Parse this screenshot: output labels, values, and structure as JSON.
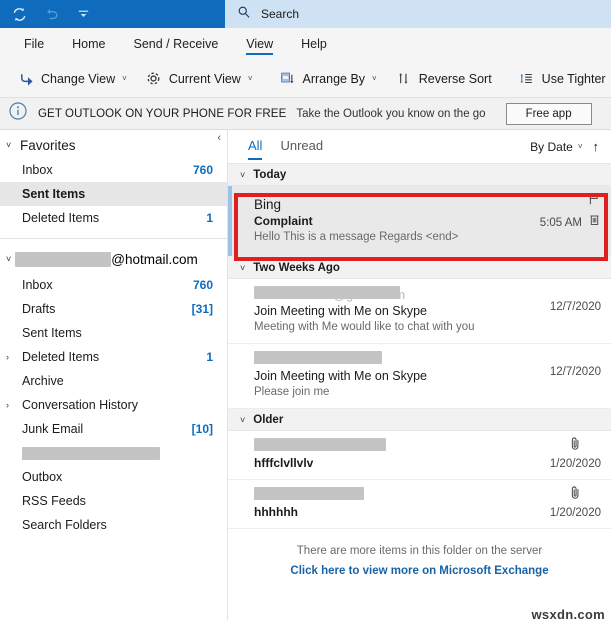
{
  "titlebar": {
    "quick_access": [
      {
        "name": "send-receive-icon",
        "label": "Send/Receive All Folders"
      },
      {
        "name": "undo-icon",
        "label": "Undo"
      },
      {
        "name": "customize-quick-access-icon",
        "label": "Customize Quick Access Toolbar"
      }
    ],
    "search_placeholder": "Search",
    "accent": "#0f6cbd"
  },
  "ribbon": {
    "tabs": [
      {
        "label": "File",
        "active": false
      },
      {
        "label": "Home",
        "active": false
      },
      {
        "label": "Send / Receive",
        "active": false
      },
      {
        "label": "View",
        "active": true
      },
      {
        "label": "Help",
        "active": false
      }
    ],
    "commands": [
      {
        "label": "Change View",
        "icon": "change-view-icon",
        "caret": "˅"
      },
      {
        "label": "Current View",
        "icon": "gear-icon",
        "caret": "˅"
      },
      {
        "label": "Arrange By",
        "icon": "arrange-by-icon",
        "caret": "˅"
      },
      {
        "label": "Reverse Sort",
        "icon": "reverse-sort-icon",
        "caret": ""
      },
      {
        "label": "Use Tighter",
        "icon": "use-tighter-icon",
        "caret": ""
      }
    ]
  },
  "banner": {
    "icon": "info-icon",
    "title": "GET OUTLOOK ON YOUR PHONE FOR FREE",
    "subtitle": "Take the Outlook you know on the go",
    "button_label": "Free app"
  },
  "sidebar": {
    "favorites": {
      "label": "Favorites",
      "twisty": "˅",
      "items": [
        {
          "label": "Inbox",
          "count": "760",
          "selected": false
        },
        {
          "label": "Sent Items",
          "count": "",
          "selected": true
        },
        {
          "label": "Deleted Items",
          "count": "1",
          "selected": false
        }
      ]
    },
    "account": {
      "redacted_user": "             ",
      "domain": "@hotmail.com",
      "twisty": "˅",
      "items": [
        {
          "label": "Inbox",
          "count": "760",
          "twisty": "",
          "redacted": false
        },
        {
          "label": "Drafts",
          "count": "[31]",
          "twisty": "",
          "redacted": false
        },
        {
          "label": "Sent Items",
          "count": "",
          "twisty": "",
          "redacted": false
        },
        {
          "label": "Deleted Items",
          "count": "1",
          "twisty": "›",
          "redacted": false
        },
        {
          "label": "Archive",
          "count": "",
          "twisty": "",
          "redacted": false
        },
        {
          "label": "Conversation History",
          "count": "",
          "twisty": "›",
          "redacted": false
        },
        {
          "label": "Junk Email",
          "count": "[10]",
          "twisty": "",
          "redacted": false
        },
        {
          "label": "",
          "count": "",
          "twisty": "",
          "redacted": true
        },
        {
          "label": "Outbox",
          "count": "",
          "twisty": "",
          "redacted": false
        },
        {
          "label": "RSS Feeds",
          "count": "",
          "twisty": "",
          "redacted": false
        },
        {
          "label": "Search Folders",
          "count": "",
          "twisty": "",
          "redacted": false
        }
      ]
    }
  },
  "maillist": {
    "filters": [
      {
        "label": "All",
        "active": true
      },
      {
        "label": "Unread",
        "active": false
      }
    ],
    "sort_label": "By Date",
    "sort_caret": "˅",
    "sort_direction_icon": "sort-ascending-arrow-icon",
    "groups": [
      {
        "label": "Today",
        "twisty": "˅",
        "messages": [
          {
            "sender": "Bing",
            "sender_redacted": false,
            "subject": "Complaint",
            "preview": "Hello  This is a message  Regards <end>",
            "date": "5:05 AM",
            "selected": true,
            "flag": true,
            "delete": true,
            "attachment": false
          }
        ]
      },
      {
        "label": "Two Weeks Ago",
        "twisty": "˅",
        "messages": [
          {
            "sender": "mounttalsoraf@gmail.com",
            "sender_redacted": true,
            "subject": "Join Meeting with Me on Skype",
            "preview": "Meeting with Me would like to chat with you",
            "date": "12/7/2020",
            "selected": false,
            "flag": false,
            "delete": false,
            "attachment": false
          },
          {
            "sender": "",
            "sender_redacted": true,
            "subject": "Join Meeting with Me on Skype",
            "preview": "Please join me",
            "date": "12/7/2020",
            "selected": false,
            "flag": false,
            "delete": false,
            "attachment": false
          }
        ]
      },
      {
        "label": "Older",
        "twisty": "˅",
        "messages": [
          {
            "sender": "",
            "sender_redacted": true,
            "subject": "hfffclvllvlv",
            "preview": "",
            "date": "1/20/2020",
            "selected": false,
            "flag": false,
            "delete": false,
            "attachment": true
          },
          {
            "sender": "",
            "sender_redacted": true,
            "subject": "hhhhhh",
            "preview": "",
            "date": "1/20/2020",
            "selected": false,
            "flag": false,
            "delete": false,
            "attachment": true
          }
        ]
      }
    ],
    "footer": {
      "more_text": "There are more items in this folder on the server",
      "more_link": "Click here to view more on Microsoft Exchange"
    }
  },
  "annotation": {
    "color": "#e02020",
    "target": "selected-message-row"
  },
  "watermark": "wsxdn.com"
}
